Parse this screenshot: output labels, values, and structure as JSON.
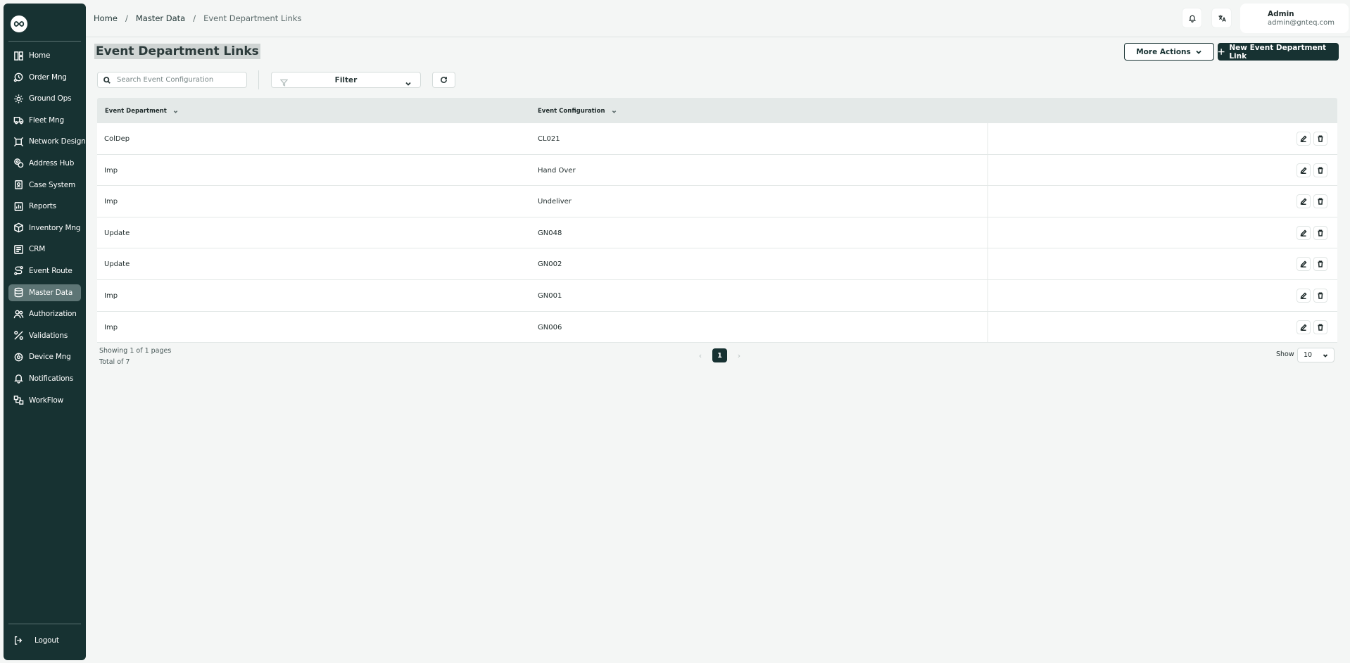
{
  "sidebar": {
    "items": [
      {
        "label": "Home",
        "icon": "home-icon",
        "active": false
      },
      {
        "label": "Order Mng",
        "icon": "order-icon",
        "active": false
      },
      {
        "label": "Ground Ops",
        "icon": "ground-ops-icon",
        "active": false
      },
      {
        "label": "Fleet Mng",
        "icon": "truck-icon",
        "active": false
      },
      {
        "label": "Network Design",
        "icon": "network-icon",
        "active": false
      },
      {
        "label": "Address Hub",
        "icon": "address-icon",
        "active": false
      },
      {
        "label": "Case System",
        "icon": "case-icon",
        "active": false
      },
      {
        "label": "Reports",
        "icon": "reports-icon",
        "active": false
      },
      {
        "label": "Inventory Mng",
        "icon": "inventory-icon",
        "active": false
      },
      {
        "label": "CRM",
        "icon": "crm-icon",
        "active": false
      },
      {
        "label": "Event Route",
        "icon": "route-icon",
        "active": false
      },
      {
        "label": "Master Data",
        "icon": "database-icon",
        "active": true
      },
      {
        "label": "Authorization",
        "icon": "users-icon",
        "active": false
      },
      {
        "label": "Validations",
        "icon": "validations-icon",
        "active": false
      },
      {
        "label": "Device Mng",
        "icon": "device-icon",
        "active": false
      },
      {
        "label": "Notifications",
        "icon": "bell-icon",
        "active": false
      },
      {
        "label": "WorkFlow",
        "icon": "workflow-icon",
        "active": false
      }
    ],
    "logout_label": "Logout"
  },
  "header": {
    "breadcrumb": [
      "Home",
      "Master Data",
      "Event Department Links"
    ],
    "breadcrumb_sep": "/",
    "user": {
      "name": "Admin",
      "email": "admin@gnteq.com"
    }
  },
  "main": {
    "title": "Event Department Links",
    "more_actions_label": "More Actions",
    "new_button_label": "New Event Department Link",
    "search_placeholder": "Search Event Configuration",
    "filter_label": "Filter"
  },
  "table": {
    "columns": [
      "Event Department",
      "Event Configuration"
    ],
    "rows": [
      [
        "ColDep",
        "CL021"
      ],
      [
        "Imp",
        "Hand Over"
      ],
      [
        "Imp",
        "Undeliver"
      ],
      [
        "Update",
        "GN048"
      ],
      [
        "Update",
        "GN002"
      ],
      [
        "Imp",
        "GN001"
      ],
      [
        "Imp",
        "GN006"
      ]
    ]
  },
  "pagination": {
    "showing": "Showing 1 of 1 pages",
    "total": "Total of 7",
    "prev": "‹",
    "next": "›",
    "current_page": "1",
    "show_label": "Show",
    "page_size": "10"
  },
  "colors": {
    "sidebar_bg": "#173232",
    "primary": "#173232",
    "active_nav": "#5d7575",
    "page_bg": "#f4f6f5"
  }
}
